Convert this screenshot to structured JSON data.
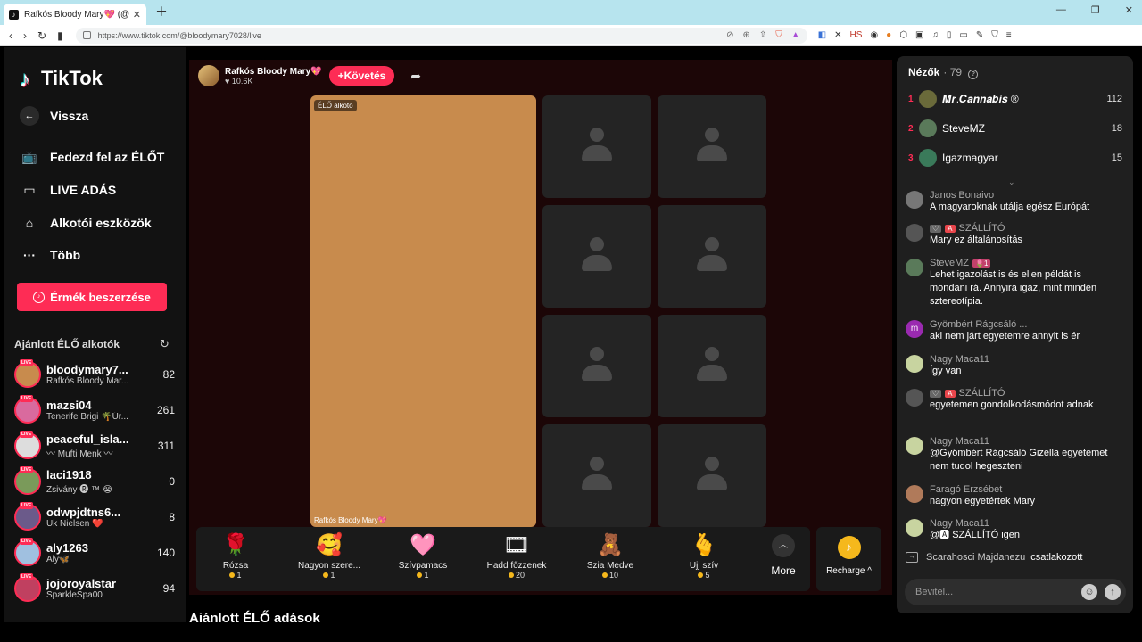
{
  "browser": {
    "tab_title": "Rafkós Bloody Mary💖 (@bl...",
    "url": "https://www.tiktok.com/@bloodymary7028/live"
  },
  "sidebar": {
    "logo": "TikTok",
    "nav": [
      {
        "label": "Vissza",
        "icon": "back-arrow-icon"
      },
      {
        "label": "Fedezd fel az ÉLŐT",
        "icon": "tv-icon"
      },
      {
        "label": "LIVE ADÁS",
        "icon": "video-camera-icon"
      },
      {
        "label": "Alkotói eszközök",
        "icon": "creator-tools-icon"
      },
      {
        "label": "Több",
        "icon": "more-dots-icon"
      }
    ],
    "coins_button": "Érmék beszerzése",
    "recommended_title": "Ajánlott ÉLŐ alkotók",
    "creators": [
      {
        "name": "bloodymary7...",
        "sub": "Rafkós Bloody Mar...",
        "count": "82",
        "color": "#c88b4d"
      },
      {
        "name": "mazsi04",
        "sub": "Tenerife Brigi 🌴Úr...",
        "count": "261",
        "color": "#d96a9e"
      },
      {
        "name": "peaceful_isla...",
        "sub": "〰 Mufti Menk 〰",
        "count": "311",
        "color": "#ddd"
      },
      {
        "name": "laci1918",
        "sub": "Zsivány 🅡 ™ 😭",
        "count": "0",
        "color": "#7a9a5a"
      },
      {
        "name": "odwpjdtns6...",
        "sub": "Uk Nielsen ❤️",
        "count": "8",
        "color": "#6b5a8a"
      },
      {
        "name": "aly1263",
        "sub": "Aly🦋",
        "count": "140",
        "color": "#a0c0e0"
      },
      {
        "name": "jojoroyalstar",
        "sub": "SparkleSpa00",
        "count": "94",
        "color": "#c04060"
      }
    ]
  },
  "stream": {
    "host_name": "Rafkós Bloody Mary💖",
    "host_likes": "10.6K",
    "follow_label": "Követés",
    "elo_badge": "ÉLŐ alkotó",
    "video_name": "Rafkós Bloody Mary💖",
    "gifts": [
      {
        "name": "Rózsa",
        "price": "1",
        "icon": "🌹"
      },
      {
        "name": "Nagyon szere...",
        "price": "1",
        "icon": "🥰"
      },
      {
        "name": "Szívpamacs",
        "price": "1",
        "icon": "🩷"
      },
      {
        "name": "Hadd főzzenek",
        "price": "20",
        "icon": "🎞"
      },
      {
        "name": "Szia Medve",
        "price": "10",
        "icon": "🧸"
      },
      {
        "name": "Ujj szív",
        "price": "5",
        "icon": "🫰"
      }
    ],
    "more_label": "More",
    "recharge_label": "Recharge ^",
    "recommended_live_title": "Ajánlott ÉLŐ adások"
  },
  "panel": {
    "viewers_label": "Nézők",
    "viewers_count": "79",
    "top_viewers": [
      {
        "rank": "1",
        "name": "𝑴𝒓.𝑪𝒂𝒏𝒏𝒂𝒃𝒊𝒔 ®",
        "score": "112",
        "color": "#6a6a3a"
      },
      {
        "rank": "2",
        "name": "SteveMZ",
        "score": "18",
        "color": "#5a7a5a"
      },
      {
        "rank": "3",
        "name": "Igazmagyar",
        "score": "15",
        "color": "#3a7a5a"
      }
    ],
    "chat": [
      {
        "user": "Janos Bonaivo",
        "text": "A magyaroknak utálja egész Európát",
        "color": "#777"
      },
      {
        "user": "SZÁLLÍTÓ",
        "text": "Mary ez általánosítás",
        "color": "#555",
        "tags": true
      },
      {
        "user": "SteveMZ",
        "badge": "🌷1",
        "text": "Lehet igazolást is és ellen példát is mondani rá. Annyira igaz, mint minden sztereotípia.",
        "color": "#5a7a5a"
      },
      {
        "user": "Gyömbért Rágcsáló ...",
        "text": "aki nem járt egyetemre annyit is ér",
        "color": "#9a2ab0",
        "letter": "m"
      },
      {
        "user": "Nagy Maca11",
        "text": "Így van",
        "color": "#c8d4a0"
      },
      {
        "user": "SZÁLLÍTÓ",
        "text": "egyetemen gondolkodásmódot adnak",
        "color": "#555",
        "tags": true
      },
      {
        "user": "Nagy Maca11",
        "text": "@Gyömbért Rágcsáló Gizella egyetemet nem tudol hegeszteni",
        "color": "#c8d4a0"
      },
      {
        "user": "Faragó Erzsébet",
        "text": "nagyon egyetértek Mary",
        "color": "#b07a5a"
      },
      {
        "user": "Nagy Maca11",
        "text": "@🅰 SZÁLLÍTÓ igen",
        "color": "#c8d4a0"
      }
    ],
    "join_user": "Scarahosci Majdanezu",
    "join_text": "csatlakozott",
    "input_placeholder": "Bevitel..."
  }
}
